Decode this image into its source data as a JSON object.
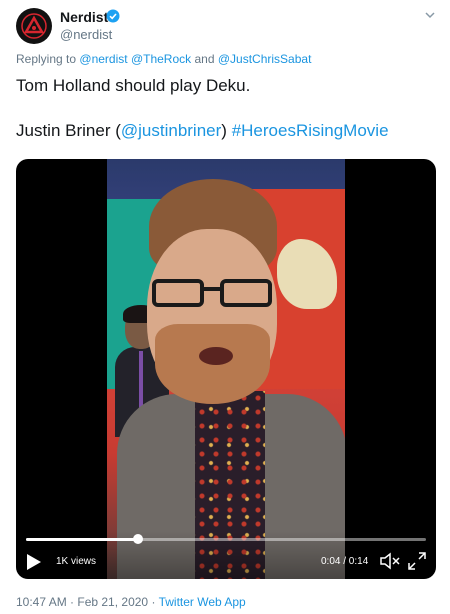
{
  "account": {
    "name": "Nerdist",
    "handle": "@nerdist",
    "verified": true,
    "avatar_icon": "nerdist-logo-icon"
  },
  "reply": {
    "prefix": "Replying to",
    "mentions": [
      "@nerdist",
      "@TheRock",
      "@JustChrisSabat"
    ],
    "and": "and"
  },
  "tweet": {
    "line1": "Tom Holland should play Deku.",
    "line2_text": "Justin Briner (",
    "line2_mention": "@justinbriner",
    "line2_close": ")",
    "line2_hashtag": "#HeroesRisingMovie"
  },
  "video": {
    "views": "1K views",
    "time": "0:04 / 0:14",
    "progress": 0.28,
    "play_icon": "play-icon",
    "mute_icon": "mute-icon",
    "fullscreen_icon": "fullscreen-icon"
  },
  "footer": {
    "timestamp": "10:47 AM · Feb 21, 2020",
    "separator": "·",
    "source": "Twitter Web App"
  },
  "colors": {
    "link": "#1b95e0",
    "muted": "#657786",
    "text": "#14171a",
    "verified": "#1da1f2",
    "avatar_accent": "#d6262f"
  }
}
